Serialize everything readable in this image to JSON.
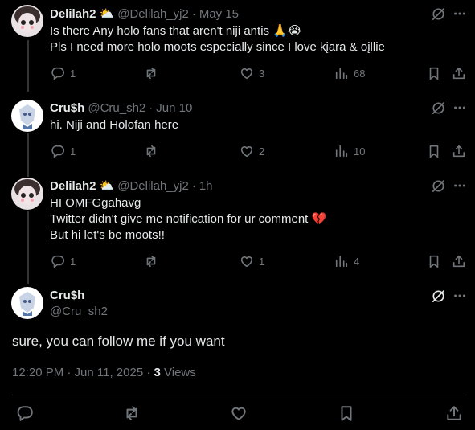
{
  "replies": [
    {
      "name": "Delilah2",
      "badge_emoji": "⛅",
      "handle": "@Delilah_yj2",
      "date": "May 15",
      "text": "Is there Any holo fans that aren't niji antis 🙏😭\nPls I need more holo moots especially since I love kįara & oįllie",
      "replies": "1",
      "reposts": "",
      "likes": "3",
      "views": "68",
      "avatar": "delilah"
    },
    {
      "name": "Cru$h",
      "badge_emoji": "",
      "handle": "@Cru_sh2",
      "date": "Jun 10",
      "text": "hi. Niji and Holofan here",
      "replies": "1",
      "reposts": "",
      "likes": "2",
      "views": "10",
      "avatar": "crush"
    },
    {
      "name": "Delilah2",
      "badge_emoji": "⛅",
      "handle": "@Delilah_yj2",
      "date": "1h",
      "text": "HI OMFGgahavg\nTwitter didn't give me notification for ur comment 💔\nBut hi let's be moots!!",
      "replies": "1",
      "reposts": "",
      "likes": "1",
      "views": "4",
      "avatar": "delilah"
    }
  ],
  "focus": {
    "name": "Cru$h",
    "handle": "@Cru_sh2",
    "text": "sure, you can follow me if you want",
    "time": "12:20 PM · Jun 11, 2025 · ",
    "views_count": "3",
    "views_label": " Views"
  },
  "icons": {
    "reply": "reply-icon",
    "repost": "repost-icon",
    "like": "like-icon",
    "views": "views-icon",
    "bookmark": "bookmark-icon",
    "share": "share-icon",
    "grok": "grok-icon",
    "more": "more-icon"
  },
  "colors": {
    "background": "#000000",
    "text": "#e7e9ea",
    "muted": "#71767b",
    "divider": "#2f3336"
  }
}
